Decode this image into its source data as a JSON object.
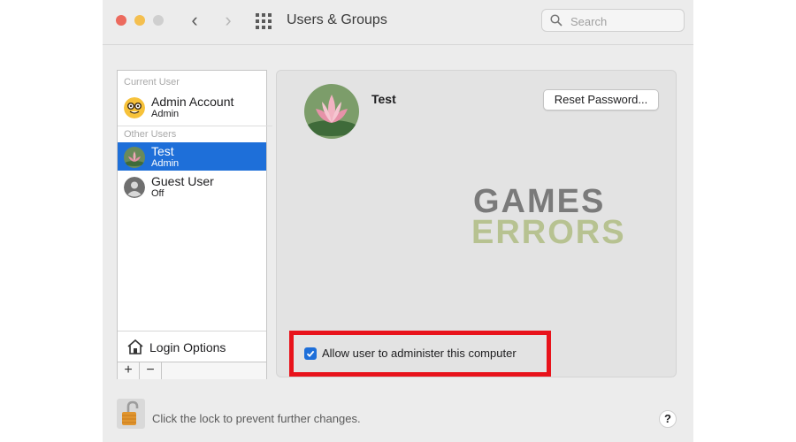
{
  "window": {
    "title": "Users & Groups",
    "search_placeholder": "Search"
  },
  "sidebar": {
    "current_user_label": "Current User",
    "other_users_label": "Other Users",
    "users": [
      {
        "name": "Admin Account",
        "role": "Admin",
        "avatar": "nerd-face-emoji"
      },
      {
        "name": "Test",
        "role": "Admin",
        "avatar": "lotus-flower-photo",
        "selected": true
      },
      {
        "name": "Guest User",
        "role": "Off",
        "avatar": "generic-person-icon"
      }
    ],
    "login_options_label": "Login Options",
    "add_label": "+",
    "remove_label": "−"
  },
  "detail": {
    "user_name": "Test",
    "reset_password_label": "Reset Password...",
    "admin_checkbox_label": "Allow user to administer this computer",
    "admin_checked": true
  },
  "watermark": {
    "line1": "GAMES",
    "line2": "ERRORS"
  },
  "footer": {
    "lock_text": "Click the lock to prevent further changes.",
    "help_label": "?"
  },
  "colors": {
    "selection": "#1e6fd9",
    "highlight_box": "#e8131b"
  }
}
